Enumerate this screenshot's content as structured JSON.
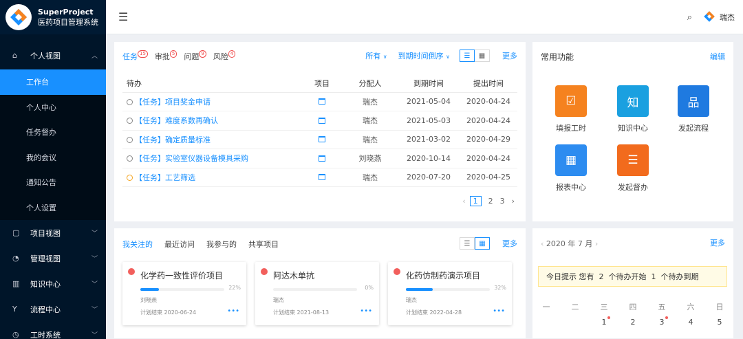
{
  "app": {
    "name": "SuperProject",
    "subtitle": "医药项目管理系统"
  },
  "sidebar": {
    "open_group": "个人视图",
    "sub_items": [
      "工作台",
      "个人中心",
      "任务督办",
      "我的会议",
      "通知公告",
      "个人设置"
    ],
    "active_sub": "工作台",
    "groups": [
      {
        "label": "项目视图",
        "icon": "project-icon"
      },
      {
        "label": "管理视图",
        "icon": "dashboard-icon"
      },
      {
        "label": "知识中心",
        "icon": "book-icon"
      },
      {
        "label": "流程中心",
        "icon": "flow-icon"
      },
      {
        "label": "工时系统",
        "icon": "clock-icon"
      }
    ]
  },
  "topbar": {
    "user_name": "瑞杰"
  },
  "todo": {
    "tabs": [
      {
        "label": "任务",
        "count": "15"
      },
      {
        "label": "审批",
        "count": "5"
      },
      {
        "label": "问题",
        "count": "9"
      },
      {
        "label": "风险",
        "count": "4"
      }
    ],
    "filter_all": "所有",
    "sort": "到期时间倒序",
    "more": "更多",
    "columns": [
      "待办",
      "项目",
      "分配人",
      "到期时间",
      "提出时间"
    ],
    "rows": [
      {
        "title": "【任务】项目奖金申请",
        "assignee": "瑞杰",
        "due": "2021-05-04",
        "created": "2020-04-24"
      },
      {
        "title": "【任务】难度系数再确认",
        "assignee": "瑞杰",
        "due": "2021-05-03",
        "created": "2020-04-24"
      },
      {
        "title": "【任务】确定质量标准",
        "assignee": "瑞杰",
        "due": "2021-03-02",
        "created": "2020-04-29"
      },
      {
        "title": "【任务】实验室仪器设备模具采购",
        "assignee": "刘晓燕",
        "due": "2020-10-14",
        "created": "2020-04-24"
      },
      {
        "title": "【任务】工艺筛选",
        "assignee": "瑞杰",
        "due": "2020-07-20",
        "created": "2020-04-25"
      }
    ],
    "pages": [
      "1",
      "2",
      "3"
    ]
  },
  "functions": {
    "title": "常用功能",
    "edit": "编辑",
    "items": [
      {
        "label": "填报工时",
        "color": "#f5821f",
        "glyph": "☑"
      },
      {
        "label": "知识中心",
        "color": "#1aa0e0",
        "glyph": "知"
      },
      {
        "label": "发起流程",
        "color": "#1f7ae0",
        "glyph": "品"
      },
      {
        "label": "报表中心",
        "color": "#2d8cf0",
        "glyph": "▦"
      },
      {
        "label": "发起督办",
        "color": "#f26b1d",
        "glyph": "☰"
      }
    ]
  },
  "projects": {
    "tabs": [
      "我关注的",
      "最近访问",
      "我参与的",
      "共享项目"
    ],
    "more": "更多",
    "cards": [
      {
        "name": "化学药一致性评价项目",
        "progress": 22,
        "progress_label": "22%",
        "owner": "刘晓燕",
        "plan": "计划结束 2020-06-24"
      },
      {
        "name": "阿达木单抗",
        "progress": 0,
        "progress_label": "0%",
        "owner": "瑞杰",
        "plan": "计划结束 2021-08-13"
      },
      {
        "name": "化药仿制药演示项目",
        "progress": 32,
        "progress_label": "32%",
        "owner": "瑞杰",
        "plan": "计划结束 2022-04-28"
      }
    ]
  },
  "calendar": {
    "month": "2020 年 7 月",
    "more": "更多",
    "notice": {
      "prefix": "今日提示 您有",
      "start_count": "2",
      "start_label": "个待办开始",
      "due_count": "1",
      "due_label": "个待办到期"
    },
    "weekdays": [
      "一",
      "二",
      "三",
      "四",
      "五",
      "六",
      "日"
    ],
    "days": [
      "",
      "",
      "1",
      "2",
      "3",
      "4",
      "5"
    ],
    "event_days": [
      "1",
      "3"
    ]
  }
}
